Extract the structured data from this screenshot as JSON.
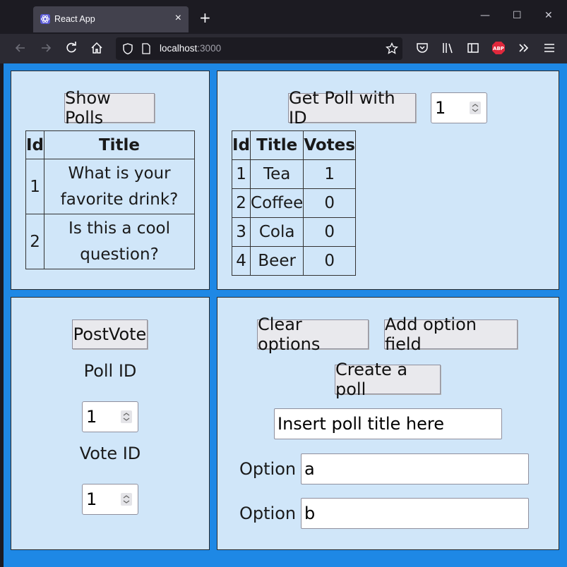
{
  "browser": {
    "tab_title": "React App",
    "tab_close": "×",
    "new_tab": "+",
    "url_host": "localhost",
    "url_port": ":3000",
    "minimize": "—",
    "maximize": "☐",
    "close": "✕"
  },
  "polls_panel": {
    "button_label": "Show Polls",
    "headers": [
      "Id",
      "Title"
    ],
    "rows": [
      {
        "id": "1",
        "title_line1": "What is your",
        "title_line2": "favorite drink?"
      },
      {
        "id": "2",
        "title_line1": "Is this a cool",
        "title_line2": "question?"
      }
    ]
  },
  "poll_detail_panel": {
    "button_label": "Get Poll with ID",
    "id_value": "1",
    "headers": [
      "Id",
      "Title",
      "Votes"
    ],
    "rows": [
      {
        "id": "1",
        "title": "Tea",
        "votes": "1"
      },
      {
        "id": "2",
        "title": "Coffee",
        "votes": "0"
      },
      {
        "id": "3",
        "title": "Cola",
        "votes": "0"
      },
      {
        "id": "4",
        "title": "Beer",
        "votes": "0"
      }
    ]
  },
  "vote_panel": {
    "button_label": "PostVote",
    "poll_id_label": "Poll ID",
    "poll_id_value": "1",
    "vote_id_label": "Vote ID",
    "vote_id_value": "1"
  },
  "create_panel": {
    "clear_label": "Clear options",
    "add_label": "Add option field",
    "create_label": "Create a poll",
    "title_input_value": "Insert poll title here",
    "options": [
      {
        "label": "Option",
        "value": "a"
      },
      {
        "label": "Option",
        "value": "b"
      }
    ]
  },
  "colors": {
    "page_background": "#1e88e5",
    "panel_background": "#d0e6f9",
    "browser_dark": "#1c1b22",
    "toolbar": "#2b2a33",
    "abp_badge": "#e0283c"
  }
}
